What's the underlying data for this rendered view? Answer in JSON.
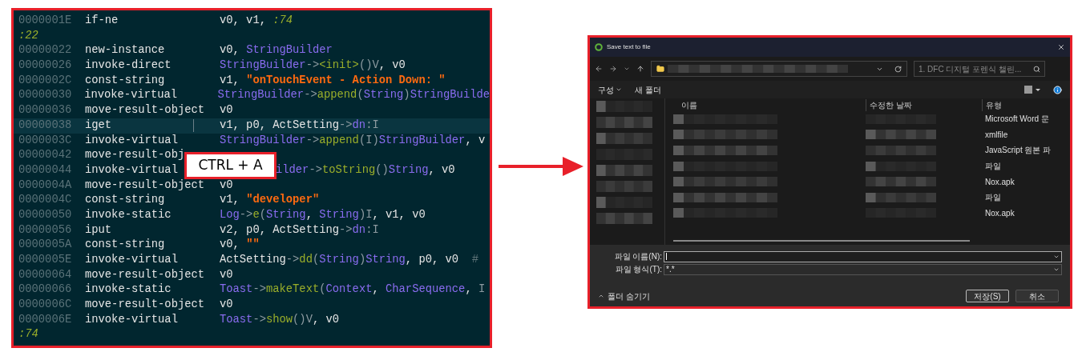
{
  "code_view": {
    "lines": [
      {
        "kind": "code",
        "addr": "0000001E",
        "op": "if-ne",
        "selected": false,
        "args": [
          {
            "t": "v0, v1, ",
            "kind": "plain"
          },
          {
            "t": ":74",
            "kind": "label"
          }
        ]
      },
      {
        "kind": "label",
        "text": ":22"
      },
      {
        "kind": "code",
        "addr": "00000022",
        "op": "new-instance",
        "selected": false,
        "args": [
          {
            "t": "v0, ",
            "kind": "plain"
          },
          {
            "t": "StringBuilder",
            "kind": "class"
          }
        ]
      },
      {
        "kind": "code",
        "addr": "00000026",
        "op": "invoke-direct",
        "selected": false,
        "args": [
          {
            "t": "StringBuilder",
            "kind": "class"
          },
          {
            "t": "->",
            "kind": "punct"
          },
          {
            "t": "<init>",
            "kind": "method"
          },
          {
            "t": "()V",
            "kind": "punct"
          },
          {
            "t": ", v0",
            "kind": "plain"
          }
        ]
      },
      {
        "kind": "code",
        "addr": "0000002C",
        "op": "const-string",
        "selected": false,
        "args": [
          {
            "t": "v1, ",
            "kind": "plain"
          },
          {
            "t": "\"onTouchEvent - Action Down: \"",
            "kind": "string"
          }
        ]
      },
      {
        "kind": "code",
        "addr": "00000030",
        "op": "invoke-virtual",
        "selected": false,
        "args": [
          {
            "t": "StringBuilder",
            "kind": "class"
          },
          {
            "t": "->",
            "kind": "punct"
          },
          {
            "t": "append",
            "kind": "method"
          },
          {
            "t": "(",
            "kind": "punct"
          },
          {
            "t": "String",
            "kind": "class"
          },
          {
            "t": ")",
            "kind": "punct"
          },
          {
            "t": "StringBuilde",
            "kind": "class"
          }
        ]
      },
      {
        "kind": "code",
        "addr": "00000036",
        "op": "move-result-object",
        "selected": false,
        "args": [
          {
            "t": "v0",
            "kind": "plain"
          }
        ]
      },
      {
        "kind": "code",
        "addr": "00000038",
        "op": "iget",
        "selected": true,
        "args": [
          {
            "t": "v1, p0, ActSetting",
            "kind": "plain"
          },
          {
            "t": "->",
            "kind": "punct"
          },
          {
            "t": "dn",
            "kind": "class"
          },
          {
            "t": ":I",
            "kind": "punct"
          }
        ]
      },
      {
        "kind": "code",
        "addr": "0000003C",
        "op": "invoke-virtual",
        "selected": false,
        "args": [
          {
            "t": "StringBuilder",
            "kind": "class"
          },
          {
            "t": "->",
            "kind": "punct"
          },
          {
            "t": "append",
            "kind": "method"
          },
          {
            "t": "(I)",
            "kind": "punct"
          },
          {
            "t": "StringBuilder",
            "kind": "class"
          },
          {
            "t": ", v",
            "kind": "plain"
          }
        ]
      },
      {
        "kind": "code",
        "addr": "00000042",
        "op": "move-result-obj",
        "selected": false
      },
      {
        "kind": "code",
        "addr": "00000044",
        "op": "invoke-virtual",
        "selected": false,
        "covered_by_callout": true,
        "args": [
          {
            "t": "ilder",
            "kind": "class"
          },
          {
            "t": "->",
            "kind": "punct"
          },
          {
            "t": "toString",
            "kind": "method"
          },
          {
            "t": "()",
            "kind": "punct"
          },
          {
            "t": "String",
            "kind": "class"
          },
          {
            "t": ", v0",
            "kind": "plain"
          }
        ]
      },
      {
        "kind": "code",
        "addr": "0000004A",
        "op": "move-result-object",
        "selected": false,
        "args": [
          {
            "t": "v0",
            "kind": "plain"
          }
        ]
      },
      {
        "kind": "code",
        "addr": "0000004C",
        "op": "const-string",
        "selected": false,
        "args": [
          {
            "t": "v1, ",
            "kind": "plain"
          },
          {
            "t": "\"developer\"",
            "kind": "string"
          }
        ]
      },
      {
        "kind": "code",
        "addr": "00000050",
        "op": "invoke-static",
        "selected": false,
        "args": [
          {
            "t": "Log",
            "kind": "class"
          },
          {
            "t": "->",
            "kind": "punct"
          },
          {
            "t": "e",
            "kind": "method"
          },
          {
            "t": "(",
            "kind": "punct"
          },
          {
            "t": "String",
            "kind": "class"
          },
          {
            "t": ", ",
            "kind": "plain"
          },
          {
            "t": "String",
            "kind": "class"
          },
          {
            "t": ")I",
            "kind": "punct"
          },
          {
            "t": ", v1, v0",
            "kind": "plain"
          }
        ]
      },
      {
        "kind": "code",
        "addr": "00000056",
        "op": "iput",
        "selected": false,
        "args": [
          {
            "t": "v2, p0, ActSetting",
            "kind": "plain"
          },
          {
            "t": "->",
            "kind": "punct"
          },
          {
            "t": "dn",
            "kind": "class"
          },
          {
            "t": ":I",
            "kind": "punct"
          }
        ]
      },
      {
        "kind": "code",
        "addr": "0000005A",
        "op": "const-string",
        "selected": false,
        "args": [
          {
            "t": "v0, ",
            "kind": "plain"
          },
          {
            "t": "\"\"",
            "kind": "string"
          }
        ]
      },
      {
        "kind": "code",
        "addr": "0000005E",
        "op": "invoke-virtual",
        "selected": false,
        "args": [
          {
            "t": "ActSetting",
            "kind": "plain"
          },
          {
            "t": "->",
            "kind": "punct"
          },
          {
            "t": "dd",
            "kind": "method"
          },
          {
            "t": "(",
            "kind": "punct"
          },
          {
            "t": "String",
            "kind": "class"
          },
          {
            "t": ")",
            "kind": "punct"
          },
          {
            "t": "String",
            "kind": "class"
          },
          {
            "t": ", p0, v0",
            "kind": "plain"
          },
          {
            "t": "  #",
            "kind": "comment"
          }
        ]
      },
      {
        "kind": "code",
        "addr": "00000064",
        "op": "move-result-object",
        "selected": false,
        "args": [
          {
            "t": "v0",
            "kind": "plain"
          }
        ]
      },
      {
        "kind": "code",
        "addr": "00000066",
        "op": "invoke-static",
        "selected": false,
        "args": [
          {
            "t": "Toast",
            "kind": "class"
          },
          {
            "t": "->",
            "kind": "punct"
          },
          {
            "t": "makeText",
            "kind": "method"
          },
          {
            "t": "(",
            "kind": "punct"
          },
          {
            "t": "Context",
            "kind": "class"
          },
          {
            "t": ", ",
            "kind": "plain"
          },
          {
            "t": "CharSequence",
            "kind": "class"
          },
          {
            "t": ", ",
            "kind": "plain"
          },
          {
            "t": "I",
            "kind": "punct"
          }
        ]
      },
      {
        "kind": "code",
        "addr": "0000006C",
        "op": "move-result-object",
        "selected": false,
        "args": [
          {
            "t": "v0",
            "kind": "plain"
          }
        ]
      },
      {
        "kind": "code",
        "addr": "0000006E",
        "op": "invoke-virtual",
        "selected": false,
        "args": [
          {
            "t": "Toast",
            "kind": "class"
          },
          {
            "t": "->",
            "kind": "punct"
          },
          {
            "t": "show",
            "kind": "method"
          },
          {
            "t": "()V",
            "kind": "punct"
          },
          {
            "t": ", v0",
            "kind": "plain"
          }
        ]
      },
      {
        "kind": "label",
        "text": ":74"
      }
    ]
  },
  "shortcut_callout": {
    "text": "CTRL + A"
  },
  "dialog": {
    "title": "Save text to file",
    "search": {
      "placeholder": "1. DFC 디지털 포렌식 챌린..."
    },
    "toolbar": {
      "organize": "구성",
      "new_folder": "새 폴더"
    },
    "columns": [
      "이름",
      "수정한 날짜",
      "유형"
    ],
    "rows": [
      {
        "type": "Microsoft Word 문"
      },
      {
        "type": "xmlfile"
      },
      {
        "type": "JavaScript 원본 파"
      },
      {
        "type": "파일"
      },
      {
        "type": "Nox.apk"
      },
      {
        "type": "파일"
      },
      {
        "type": "Nox.apk"
      }
    ],
    "file_name": {
      "label": "파일 이름(N):"
    },
    "file_type": {
      "label": "파일 형식(T):",
      "value": "*.*"
    },
    "hide_folders": "폴더 숨기기",
    "buttons": {
      "save": "저장(S)",
      "cancel": "취소"
    }
  }
}
